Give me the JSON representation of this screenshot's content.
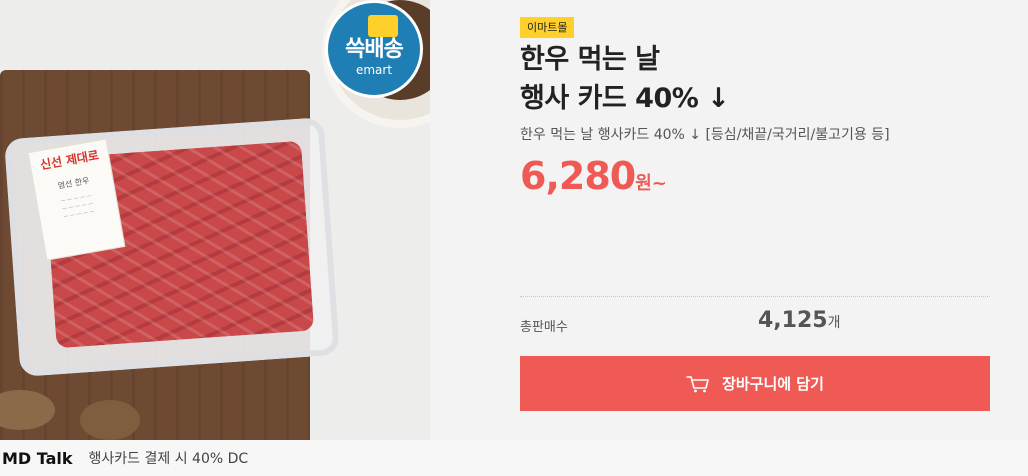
{
  "product": {
    "seller": "이마트몰",
    "title_line1": "한우 먹는 날",
    "title_line2": "행사 카드 40% ↓",
    "subtitle": "한우 먹는 날 행사카드 40% ↓ [등심/채끝/국거리/불고기용 등]",
    "price": "6,280",
    "price_unit": "원~"
  },
  "image": {
    "badge_main": "쓱배송",
    "badge_sub": "emart",
    "label_red": "신선 제대로",
    "label_sub": "엄선 한우"
  },
  "sales": {
    "label": "총판매수",
    "value": "4,125",
    "unit": "개"
  },
  "cart": {
    "label": "장바구니에 담기"
  },
  "md_talk": {
    "title": "MD Talk",
    "text": "행사카드 결제 시 40% DC"
  },
  "colors": {
    "accent": "#f05a55",
    "seller_badge": "#ffd02a"
  }
}
